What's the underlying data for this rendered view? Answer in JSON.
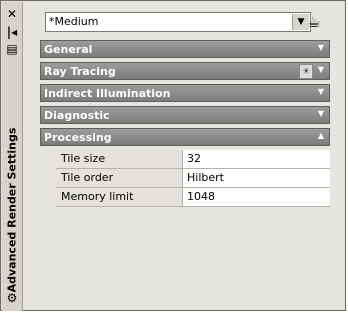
{
  "panel": {
    "title": "Advanced Render Settings"
  },
  "preset": {
    "value": "*Medium"
  },
  "sections": [
    {
      "label": "General",
      "expanded": false,
      "has_bulb": false
    },
    {
      "label": "Ray Tracing",
      "expanded": false,
      "has_bulb": true
    },
    {
      "label": "Indirect Illumination",
      "expanded": false,
      "has_bulb": false
    },
    {
      "label": "Diagnostic",
      "expanded": false,
      "has_bulb": false
    },
    {
      "label": "Processing",
      "expanded": true,
      "has_bulb": false
    }
  ],
  "processing": {
    "rows": [
      {
        "key": "Tile size",
        "value": "32"
      },
      {
        "key": "Tile order",
        "value": "Hilbert"
      },
      {
        "key": "Memory limit",
        "value": "1048"
      }
    ]
  },
  "icons": {
    "close": "close-icon",
    "auto_hide": "auto-hide-icon",
    "properties": "properties-icon",
    "settings": "settings-icon",
    "render_tool": "render-preset-icon",
    "collapse": "chevron-down-icon",
    "expand": "chevron-up-icon",
    "bulb": "lightbulb-icon"
  }
}
